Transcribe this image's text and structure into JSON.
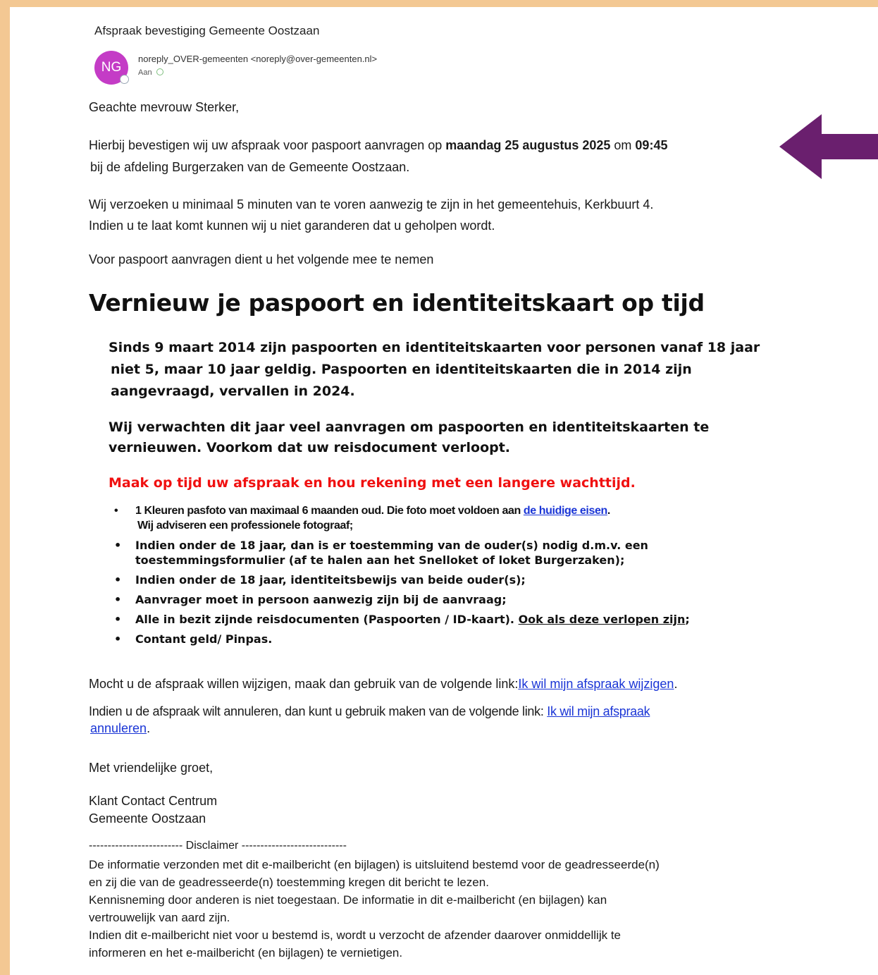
{
  "email": {
    "subject": "Afspraak bevestiging Gemeente Oostzaan",
    "avatar_initials": "NG",
    "sender": "noreply_OVER-gemeenten <noreply@over-gemeenten.nl>",
    "to_label": "Aan"
  },
  "body": {
    "greeting": "Geachte mevrouw Sterker,",
    "confirm_pre": "Hierbij bevestigen wij uw afspraak voor paspoort aanvragen op ",
    "confirm_date": "maandag 25 augustus 2025",
    "confirm_mid": " om ",
    "confirm_time": "09:45",
    "confirm_line2": "bij de afdeling Burgerzaken van de Gemeente Oostzaan.",
    "arrive_line1": "Wij verzoeken u minimaal 5 minuten van te voren aanwezig te zijn in het gemeentehuis, Kerkbuurt 4.",
    "arrive_line2": "Indien u te laat komt kunnen wij u niet garanderen dat u geholpen wordt.",
    "bring_intro": "Voor paspoort aanvragen dient u het volgende mee te nemen",
    "headline": "Vernieuw je paspoort en identiteitskaart op tijd",
    "para1_line1": "Sinds 9 maart 2014 zijn paspoorten en identiteitskaarten voor personen vanaf 18 jaar",
    "para1_line2": "niet 5, maar 10 jaar geldig. Paspoorten en identiteitskaarten die in 2014 zijn",
    "para1_line3": "aangevraagd, vervallen in 2024.",
    "para2_line1": "Wij verwachten dit jaar veel aanvragen om paspoorten en identiteitskaarten te",
    "para2_line2": "vernieuwen. Voorkom dat uw reisdocument verloopt.",
    "red_line": "Maak op tijd uw afspraak en hou rekening met een langere wachttijd.",
    "bullet": "•",
    "req1_pre": "1 Kleuren pasfoto van maximaal 6 maanden oud. Die foto moet voldoen aan ",
    "req1_link": "de huidige eisen",
    "req1_post": ".",
    "req1_line2": "Wij adviseren een professionele fotograaf;",
    "req2_line1": "Indien onder de 18 jaar, dan is er toestemming van de ouder(s) nodig d.m.v. een",
    "req2_line2": "toestemmingsformulier (af te halen aan het Snelloket of loket Burgerzaken);",
    "req3": "Indien onder de 18 jaar, identiteitsbewijs van beide ouder(s);",
    "req4": "Aanvrager moet in persoon aanwezig zijn bij de aanvraag;",
    "req5_pre": "Alle in bezit zijnde reisdocumenten (Paspoorten / ID-kaart). ",
    "req5_underline": "Ook als deze verlopen zijn",
    "req5_post": ";",
    "req6": "Contant geld/ Pinpas.",
    "change_pre": "Mocht u de afspraak willen wijzigen, maak dan gebruik van de volgende link:",
    "change_link": "Ik wil mijn afspraak wijzigen",
    "change_post": ".",
    "cancel_pre": "Indien u de afspraak wilt annuleren, dan kunt u gebruik maken van de volgende link: ",
    "cancel_link_line1": "Ik wil mijn afspraak",
    "cancel_link_line2": "annuleren",
    "cancel_post": ".",
    "closing": "Met vriendelijke groet,",
    "sign1": "Klant Contact Centrum",
    "sign2": "Gemeente Oostzaan",
    "disclaimer_header": "------------------------- Disclaimer ----------------------------",
    "disc1": "De informatie verzonden met dit e-mailbericht (en bijlagen) is uitsluitend bestemd voor de geadresseerde(n)",
    "disc2": "en zij die van de geadresseerde(n) toestemming kregen dit bericht te lezen.",
    "disc3": "Kennisneming door anderen is niet toegestaan. De informatie in dit e-mailbericht (en bijlagen) kan",
    "disc4": "vertrouwelijk van aard zijn.",
    "disc5": "Indien dit e-mailbericht niet voor u bestemd is, wordt u verzocht de afzender daarover onmiddellijk te",
    "disc6": "informeren en het e-mailbericht (en bijlagen) te vernietigen."
  },
  "colors": {
    "frame": "#f3c893",
    "avatar": "#c43cc6",
    "arrow": "#6a1f6e",
    "warning": "#f01010",
    "link": "#1a35d6"
  },
  "icons": {
    "arrow": "left-arrow-icon",
    "presence": "presence-status-icon"
  }
}
